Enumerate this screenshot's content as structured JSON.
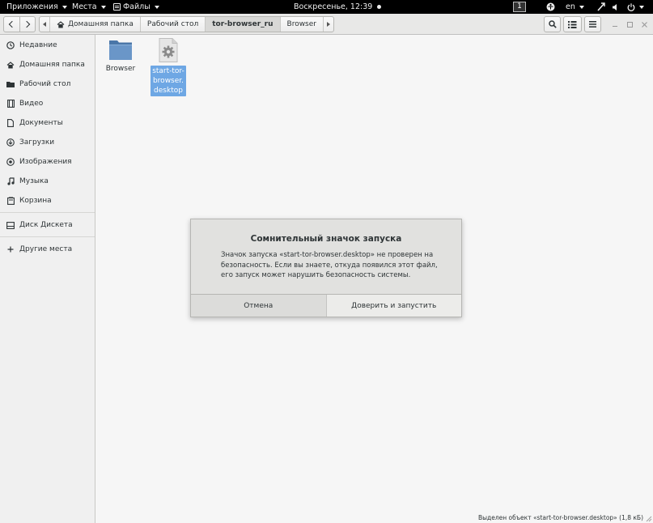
{
  "topbar": {
    "applications": "Приложения",
    "places": "Места",
    "files": "Файлы",
    "clock": "Воскресенье, 12:39",
    "workspace": "1",
    "language": "en"
  },
  "header": {
    "path": [
      {
        "label": "Домашняя папка",
        "home": true
      },
      {
        "label": "Рабочий стол",
        "home": false
      },
      {
        "label": "tor-browser_ru",
        "home": false,
        "active": true
      },
      {
        "label": "Browser",
        "home": false
      }
    ]
  },
  "sidebar": {
    "items": [
      {
        "label": "Недавние",
        "icon": "clock-icon"
      },
      {
        "label": "Домашняя папка",
        "icon": "home-icon"
      },
      {
        "label": "Рабочий стол",
        "icon": "desktop-folder-icon"
      },
      {
        "label": "Видео",
        "icon": "video-icon"
      },
      {
        "label": "Документы",
        "icon": "document-icon"
      },
      {
        "label": "Загрузки",
        "icon": "download-icon"
      },
      {
        "label": "Изображения",
        "icon": "image-icon"
      },
      {
        "label": "Музыка",
        "icon": "music-icon"
      },
      {
        "label": "Корзина",
        "icon": "trash-icon"
      },
      {
        "label": "Диск Дискета",
        "icon": "drive-icon"
      },
      {
        "label": "Другие места",
        "icon": "plus-icon"
      }
    ]
  },
  "files": [
    {
      "name": "Browser",
      "type": "folder"
    },
    {
      "name": "start-tor-\nbrowser.\ndesktop",
      "type": "desktop-file",
      "selected": true
    }
  ],
  "dialog": {
    "title": "Сомнительный значок запуска",
    "body": "Значок запуска «start-tor-browser.desktop» не проверен на безопасность. Если вы знаете, откуда появился этот файл, его запуск может нарушить безопасность системы.",
    "cancel": "Отмена",
    "trust": "Доверить и запустить"
  },
  "status": "Выделен объект «start-tor-browser.desktop»  (1,8 кБ)",
  "colors": {
    "selection": "#6ea7e4",
    "folder": "#5b86b8",
    "topbar": "#000000"
  }
}
